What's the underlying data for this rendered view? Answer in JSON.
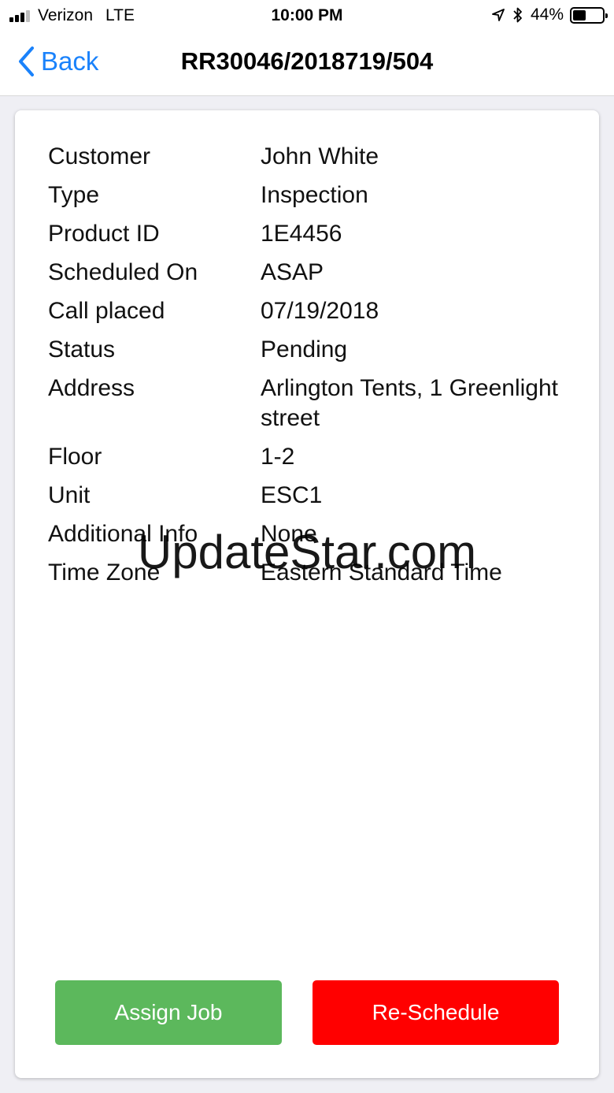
{
  "status_bar": {
    "carrier": "Verizon",
    "network": "LTE",
    "time": "10:00 PM",
    "battery_percent": "44%",
    "battery_level": 0.44
  },
  "nav": {
    "back_label": "Back",
    "title": "RR30046/2018719/504"
  },
  "details": [
    {
      "label": "Customer",
      "value": "John White"
    },
    {
      "label": "Type",
      "value": "Inspection"
    },
    {
      "label": "Product ID",
      "value": "1E4456"
    },
    {
      "label": "Scheduled On",
      "value": "ASAP"
    },
    {
      "label": "Call placed",
      "value": "07/19/2018"
    },
    {
      "label": "Status",
      "value": "Pending"
    },
    {
      "label": "Address",
      "value": "Arlington Tents, 1 Greenlight street"
    },
    {
      "label": "Floor",
      "value": "1-2"
    },
    {
      "label": "Unit",
      "value": "ESC1"
    },
    {
      "label": "Additional Info",
      "value": "None"
    },
    {
      "label": "Time Zone",
      "value": "Eastern Standard Time"
    }
  ],
  "actions": {
    "assign_label": "Assign Job",
    "reschedule_label": "Re-Schedule"
  },
  "watermark": "UpdateStar.com",
  "colors": {
    "accent": "#1a82fb",
    "assign": "#5cb85c",
    "reschedule": "#ff0000"
  },
  "icons": [
    "signal-icon",
    "location-arrow-icon",
    "bluetooth-icon",
    "battery-icon",
    "chevron-left-icon"
  ]
}
